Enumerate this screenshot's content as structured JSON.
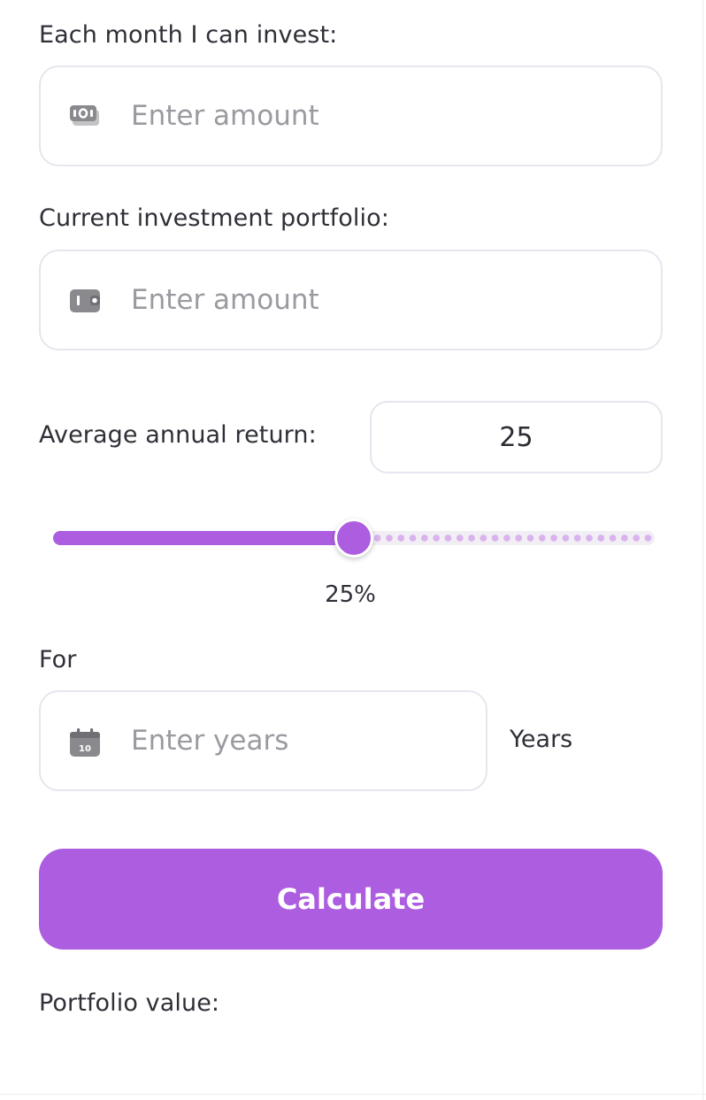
{
  "monthly": {
    "label": "Each month I can invest:",
    "placeholder": "Enter amount",
    "value": "",
    "icon": "cash-icon"
  },
  "portfolio": {
    "label": "Current investment portfolio:",
    "placeholder": "Enter amount",
    "value": "",
    "icon": "wallet-icon"
  },
  "annual_return": {
    "label": "Average annual return:",
    "value": "25",
    "slider_percent": 25,
    "slider_label": "25%"
  },
  "period": {
    "label": "For",
    "placeholder": "Enter years",
    "value": "",
    "icon": "calendar-icon",
    "calendar_day": "10",
    "unit": "Years"
  },
  "calculate_button": "Calculate",
  "result": {
    "label": "Portfolio value:"
  },
  "colors": {
    "accent": "#ad5ee0",
    "accent_light": "#d9b2ee",
    "border": "#e7e5ee",
    "text": "#2f3037",
    "placeholder": "#9a9aa1",
    "icon": "#8a8a8e"
  }
}
